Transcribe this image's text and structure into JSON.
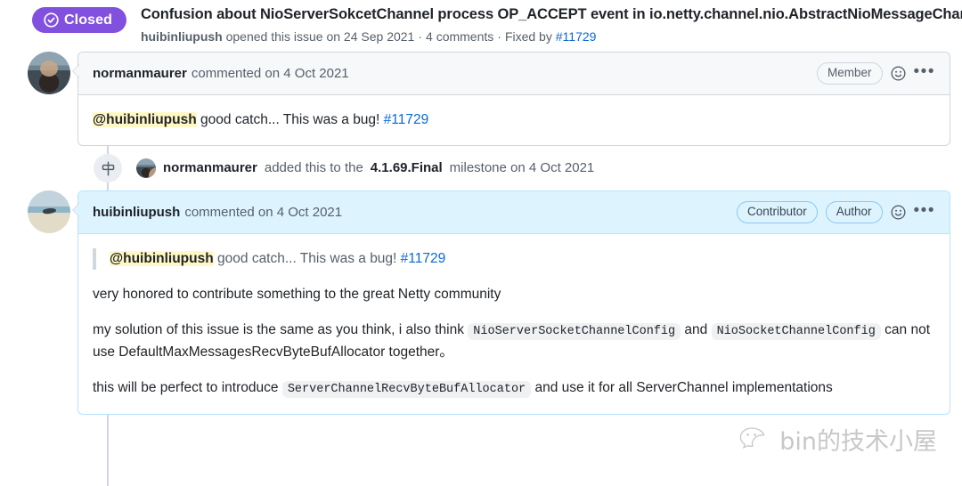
{
  "issue": {
    "state_label": "Closed",
    "state_color": "#8250df",
    "title": "Confusion about NioServerSokcetChannel process OP_ACCEPT event in io.netty.channel.nio.AbstractNioMessageChannel",
    "meta": {
      "author": "huibinliupush",
      "opened_text": "opened this issue on 24 Sep 2021",
      "comments_text": "4 comments",
      "fixed_by_text": "Fixed by",
      "fixed_by_link": "#11729"
    }
  },
  "comments": [
    {
      "author": "normanmaurer",
      "commented_text": "commented on 4 Oct 2021",
      "badges": [
        "Member"
      ],
      "body": {
        "mention": "@huibinliupush",
        "text": " good catch... This was a bug! ",
        "link": "#11729"
      }
    },
    {
      "author": "huibinliupush",
      "commented_text": "commented on 4 Oct 2021",
      "badges": [
        "Contributor",
        "Author"
      ],
      "quote": {
        "mention": "@huibinliupush",
        "text": " good catch... This was a bug! ",
        "link": "#11729"
      },
      "paragraphs": {
        "p1": "very honored to contribute something to the great Netty community",
        "p2_a": "my solution of this issue is the same as you think,  i also think ",
        "p2_code1": "NioServerSocketChannelConfig",
        "p2_b": " and ",
        "p2_code2": "NioSocketChannelConfig",
        "p2_c": " can not use DefaultMaxMessagesRecvByteBufAllocator together。",
        "p3_a": "this will be perfect to introduce ",
        "p3_code1": "ServerChannelRecvByteBufAllocator",
        "p3_b": " and use it for all ServerChannel implementations"
      }
    }
  ],
  "timeline_event": {
    "actor": "normanmaurer",
    "action_before": "added this to the",
    "milestone": "4.1.69.Final",
    "action_after": "milestone on 4 Oct 2021",
    "icon": "milestone-icon"
  },
  "watermark": {
    "text": "bin的技术小屋",
    "icon": "wechat-icon"
  },
  "icons": {
    "check_circle": "check-circle-icon",
    "smiley": "smiley-icon",
    "kebab": "•••"
  }
}
